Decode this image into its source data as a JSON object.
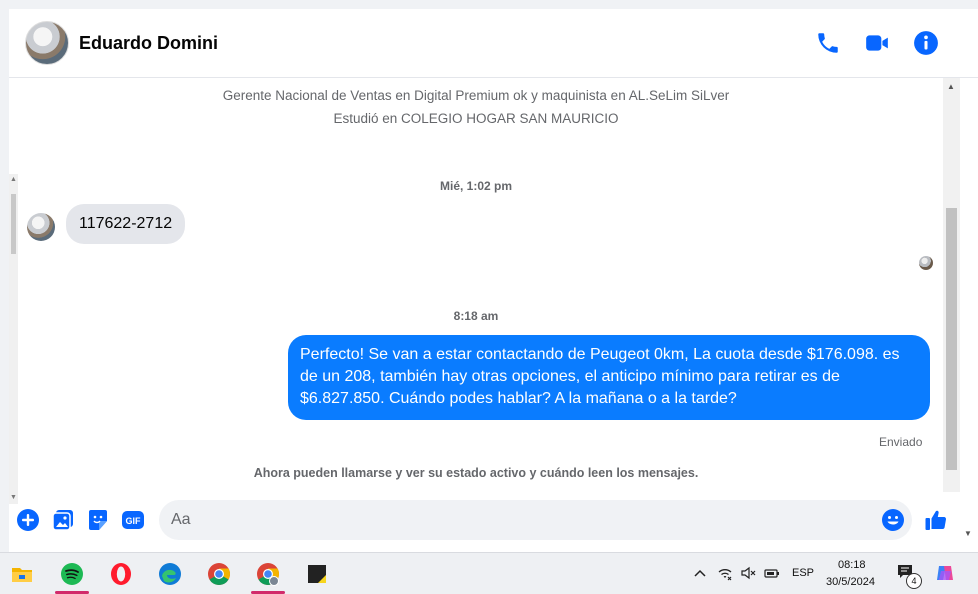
{
  "header": {
    "contact_name": "Eduardo Domini",
    "icons": [
      "phone-icon",
      "video-camera-icon",
      "info-icon"
    ]
  },
  "profile": {
    "work": "Gerente Nacional de Ventas en Digital Premium ok y maquinista en AL.SeLim SiLver",
    "education": "Estudió en COLEGIO HOGAR SAN MAURICIO"
  },
  "messages": {
    "time_1": "Mié, 1:02 pm",
    "incoming_1": "117622-2712",
    "time_2": "8:18 am",
    "outgoing_1": "Perfecto!  Se van a estar contactando de Peugeot 0km, La cuota desde $176.098. es de un 208, también hay otras opciones, el anticipo mínimo para retirar es de $6.827.850. Cuándo podes hablar? A la mañana o a la tarde?",
    "sent_status": "Enviado",
    "notice": "Ahora pueden llamarse y ver su estado activo y cuándo leen los mensajes."
  },
  "composer": {
    "placeholder": "Aa",
    "gif_label": "GIF"
  },
  "taskbar": {
    "apps": [
      "file-explorer-icon",
      "spotify-icon",
      "opera-icon",
      "edge-icon",
      "chrome-icon",
      "chrome-profile-icon",
      "sticky-notes-icon"
    ],
    "language": "ESP",
    "time": "08:18",
    "date": "30/5/2024",
    "notification_count": "4"
  },
  "colors": {
    "accent": "#0a7cff",
    "icon_blue": "#0866ff",
    "incoming_bubble": "#e4e6eb",
    "taskbar_active": "#d22b6b"
  }
}
